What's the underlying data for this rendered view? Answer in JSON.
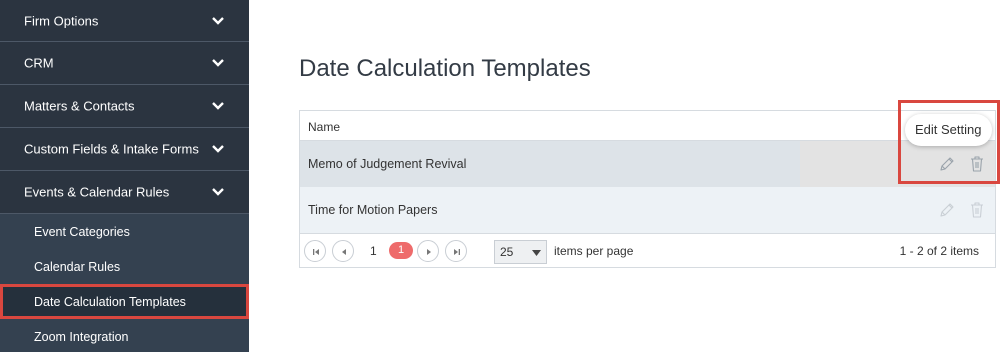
{
  "sidebar": {
    "sections": [
      {
        "label": "Firm Options"
      },
      {
        "label": "CRM"
      },
      {
        "label": "Matters & Contacts"
      },
      {
        "label": "Custom Fields & Intake Forms"
      },
      {
        "label": "Events & Calendar Rules"
      }
    ],
    "subitems": [
      {
        "label": "Event Categories"
      },
      {
        "label": "Calendar Rules"
      },
      {
        "label": "Date Calculation Templates",
        "active": true
      },
      {
        "label": "Zoom Integration"
      }
    ]
  },
  "main": {
    "title": "Date Calculation Templates",
    "grid": {
      "columns": [
        "Name"
      ],
      "rows": [
        {
          "name": "Memo of Judgement Revival"
        },
        {
          "name": "Time for Motion Papers"
        }
      ]
    },
    "tooltip": "Edit Setting",
    "pager": {
      "current_page": "1",
      "active_page": "1",
      "page_size": "25",
      "per_page_label": "items per page",
      "info": "1 - 2 of 2 items"
    }
  },
  "icons": [
    "chevron-down-icon",
    "pencil-icon",
    "trash-icon",
    "first-page-icon",
    "prev-page-icon",
    "next-page-icon",
    "last-page-icon",
    "dropdown-caret-icon"
  ],
  "colors": {
    "sidebar_bg": "#2b3440",
    "subnav_bg": "#344150",
    "highlight": "#d9473f",
    "active_page": "#ee6b6b",
    "row_selected": "#dde3e8",
    "row_alt": "#edf2f6"
  }
}
